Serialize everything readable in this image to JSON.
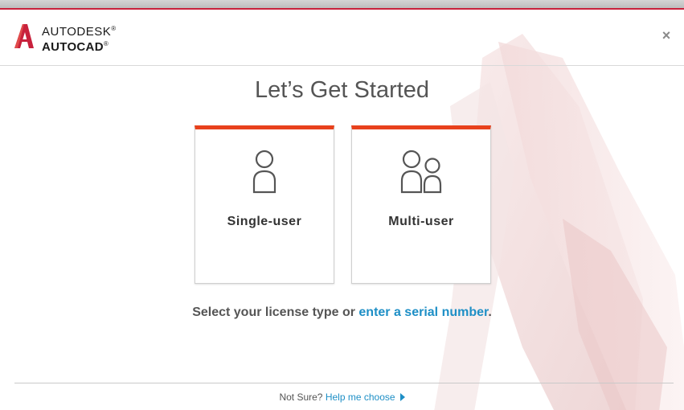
{
  "brand": {
    "company": "AUTODESK",
    "company_mark": "®",
    "product": "AUTOCAD",
    "product_mark": "®"
  },
  "window": {
    "close_glyph": "×"
  },
  "main": {
    "title": "Let’s Get Started",
    "cards": [
      {
        "label": "Single-user",
        "icon": "single-user-icon"
      },
      {
        "label": "Multi-user",
        "icon": "multi-user-icon"
      }
    ],
    "prompt_text": "Select your license type or ",
    "prompt_link": "enter a serial number",
    "prompt_end": "."
  },
  "footer": {
    "not_sure": "Not Sure?",
    "help_link": "Help me choose"
  },
  "colors": {
    "accent": "#e8411c",
    "brand_red": "#c8213c",
    "link": "#1e8fc6"
  }
}
